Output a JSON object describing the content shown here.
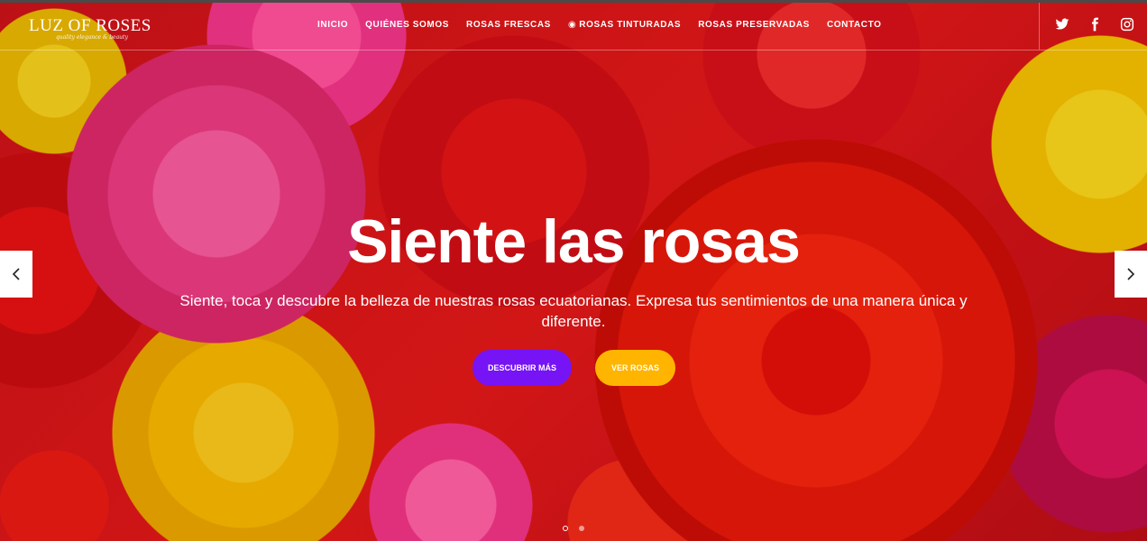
{
  "brand": {
    "name": "LUZ OF ROSES",
    "tagline": "quality elegance & beauty"
  },
  "nav": {
    "items": [
      {
        "label": "INICIO"
      },
      {
        "label": "QUIÉNES SOMOS"
      },
      {
        "label": "ROSAS FRESCAS"
      },
      {
        "label": "ROSAS TINTURADAS",
        "icon": "target-icon"
      },
      {
        "label": "ROSAS PRESERVADAS"
      },
      {
        "label": "CONTACTO"
      }
    ]
  },
  "social": [
    "twitter-icon",
    "facebook-icon",
    "instagram-icon"
  ],
  "hero": {
    "headline": "Siente las rosas",
    "subtitle": "Siente, toca y descubre la belleza de nuestras rosas ecuatorianas. Expresa tus sentimientos de una manera única y diferente.",
    "primary_button": "DESCUBRIR MÁS",
    "secondary_button": "VER ROSAS",
    "slides_total": 2,
    "active_slide": 1
  },
  "colors": {
    "primary_button": "#7614f5",
    "secondary_button": "#ffb500",
    "text": "#ffffff"
  }
}
